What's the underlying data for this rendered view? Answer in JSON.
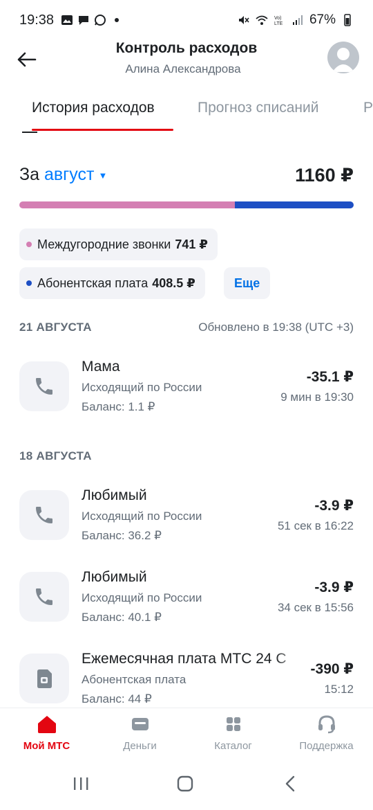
{
  "status_bar": {
    "time": "19:38",
    "battery": "67%",
    "icons": [
      "image-icon",
      "message-icon",
      "whatsapp-icon",
      "mute-icon",
      "wifi-icon",
      "volte-icon",
      "signal-icon",
      "battery-icon"
    ]
  },
  "header": {
    "title": "Контроль расходов",
    "subtitle": "Алина Александрова"
  },
  "tabs": [
    {
      "label": "История расходов",
      "active": true
    },
    {
      "label": "Прогноз списаний",
      "active": false
    },
    {
      "label": "Р",
      "active": false
    }
  ],
  "period": {
    "prefix": "За",
    "month": "август",
    "total": "1160 ₽"
  },
  "breakdown": {
    "shares": [
      741,
      408.5
    ],
    "colors": [
      "#d47fb3",
      "#1d4fc4"
    ],
    "chips": [
      {
        "label": "Междугородние звонки",
        "amount": "741 ₽",
        "color": "#d47fb3"
      },
      {
        "label": "Абонентская плата",
        "amount": "408.5 ₽",
        "color": "#1d4fc4"
      }
    ],
    "more_label": "Еще"
  },
  "days": [
    {
      "date": "21 АВГУСТА",
      "updated": "Обновлено в 19:38 (UTC +3)",
      "items": [
        {
          "icon": "phone-icon",
          "name": "Мама",
          "desc": "Исходящий по России",
          "balance": "Баланс: 1.1 ₽",
          "amount": "-35.1 ₽",
          "meta": "9 мин в 19:30"
        }
      ]
    },
    {
      "date": "18 АВГУСТА",
      "items": [
        {
          "icon": "phone-icon",
          "name": "Любимый",
          "desc": "Исходящий по России",
          "balance": "Баланс: 36.2 ₽",
          "amount": "-3.9 ₽",
          "meta": "51 сек в 16:22"
        },
        {
          "icon": "phone-icon",
          "name": "Любимый",
          "desc": "Исходящий по России",
          "balance": "Баланс: 40.1 ₽",
          "amount": "-3.9 ₽",
          "meta": "34 сек в 15:56"
        },
        {
          "icon": "subscription-icon",
          "name": "Ежемесячная плата МТС 24 С",
          "desc": "Абонентская плата",
          "balance": "Баланс: 44 ₽",
          "amount": "-390 ₽",
          "meta": "15:12"
        }
      ]
    }
  ],
  "bottom_nav": [
    {
      "label": "Мой МТС",
      "icon": "home-icon",
      "active": true
    },
    {
      "label": "Деньги",
      "icon": "wallet-icon",
      "active": false
    },
    {
      "label": "Каталог",
      "icon": "grid-icon",
      "active": false
    },
    {
      "label": "Поддержка",
      "icon": "headset-icon",
      "active": false
    }
  ],
  "colors": {
    "accent": "#e30611",
    "link": "#007cff",
    "muted": "#626c77"
  }
}
